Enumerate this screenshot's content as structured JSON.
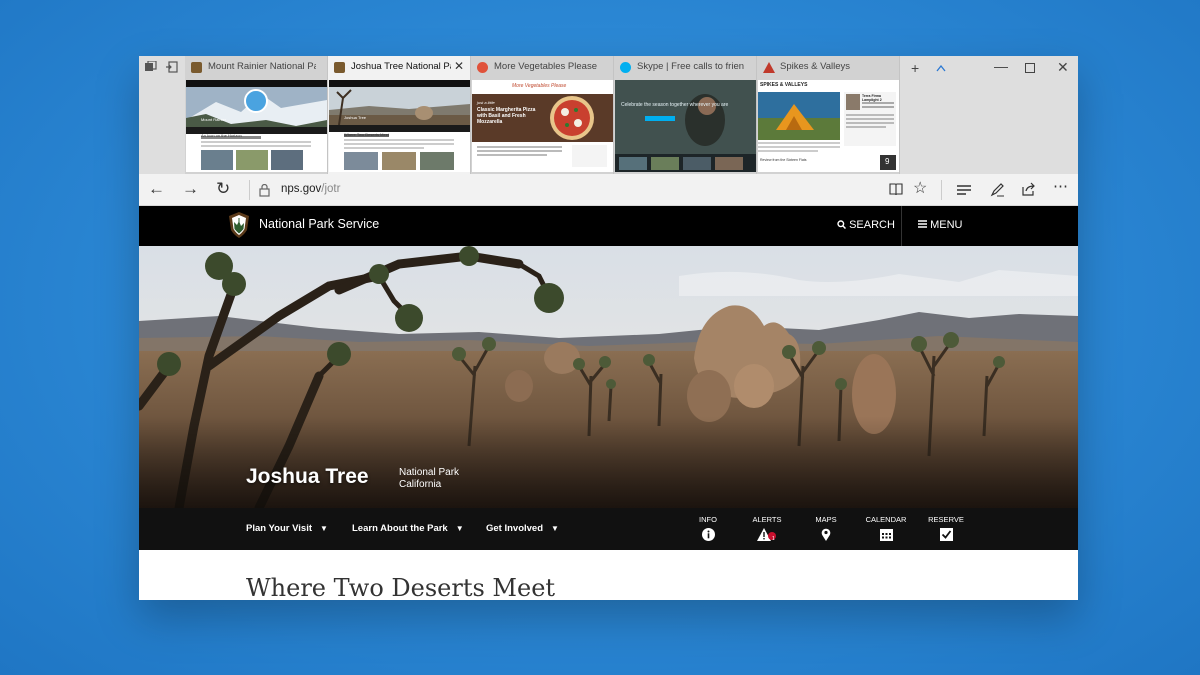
{
  "browser": {
    "tabs": [
      {
        "title": "Mount Rainier National Pa",
        "active": false,
        "favicon_color": "#7a5a2e"
      },
      {
        "title": "Joshua Tree National Park",
        "active": true,
        "favicon_color": "#7a5a2e"
      },
      {
        "title": "More Vegetables Please",
        "active": false,
        "favicon_color": "#e0523a"
      },
      {
        "title": "Skype | Free calls to frien",
        "active": false,
        "favicon_color": "#00aff0"
      },
      {
        "title": "Spikes & Valleys",
        "active": false,
        "favicon_color": "#c0392b"
      }
    ],
    "thumbnails": {
      "rainier": {
        "caption": "An Icon on the Horizon",
        "heading": "Mount Rainier"
      },
      "joshua": {
        "caption": "Where Two Deserts Meet",
        "heading": "Joshua Tree"
      },
      "veg": {
        "site": "More Vegetables Please",
        "recipe_prefix": "just a little",
        "recipe": "Classic Margherita Pizza with Basil and Fresh Mozzarella"
      },
      "skype": {
        "tagline": "Celebrate the season together wherever you are"
      },
      "spikes": {
        "site": "SPIKES & VALLEYS",
        "article": "Terra Firma Lamplight 2",
        "footer": "Review from the Sixteen Flats",
        "page_num": "9"
      }
    },
    "address": {
      "domain": "nps.gov",
      "path": "/jotr"
    }
  },
  "page": {
    "header": {
      "site_name": "National Park Service",
      "search_label": "SEARCH",
      "menu_label": "MENU"
    },
    "hero": {
      "title": "Joshua Tree",
      "subtitle_line1": "National Park",
      "subtitle_line2": "California"
    },
    "subnav": [
      {
        "label": "Plan Your Visit"
      },
      {
        "label": "Learn About the Park"
      },
      {
        "label": "Get Involved"
      }
    ],
    "quick_links": [
      {
        "label": "INFO",
        "icon": "info-icon"
      },
      {
        "label": "ALERTS",
        "icon": "alert-icon",
        "badge": "1"
      },
      {
        "label": "MAPS",
        "icon": "map-pin-icon"
      },
      {
        "label": "CALENDAR",
        "icon": "calendar-icon"
      },
      {
        "label": "RESERVE",
        "icon": "checkbox-icon"
      }
    ],
    "content_title": "Where Two Deserts Meet"
  },
  "colors": {
    "desktop_bg": "#2a86d3",
    "nps_bar": "#000000",
    "subnav_bg": "#111111",
    "alert_badge": "#c8102e"
  }
}
